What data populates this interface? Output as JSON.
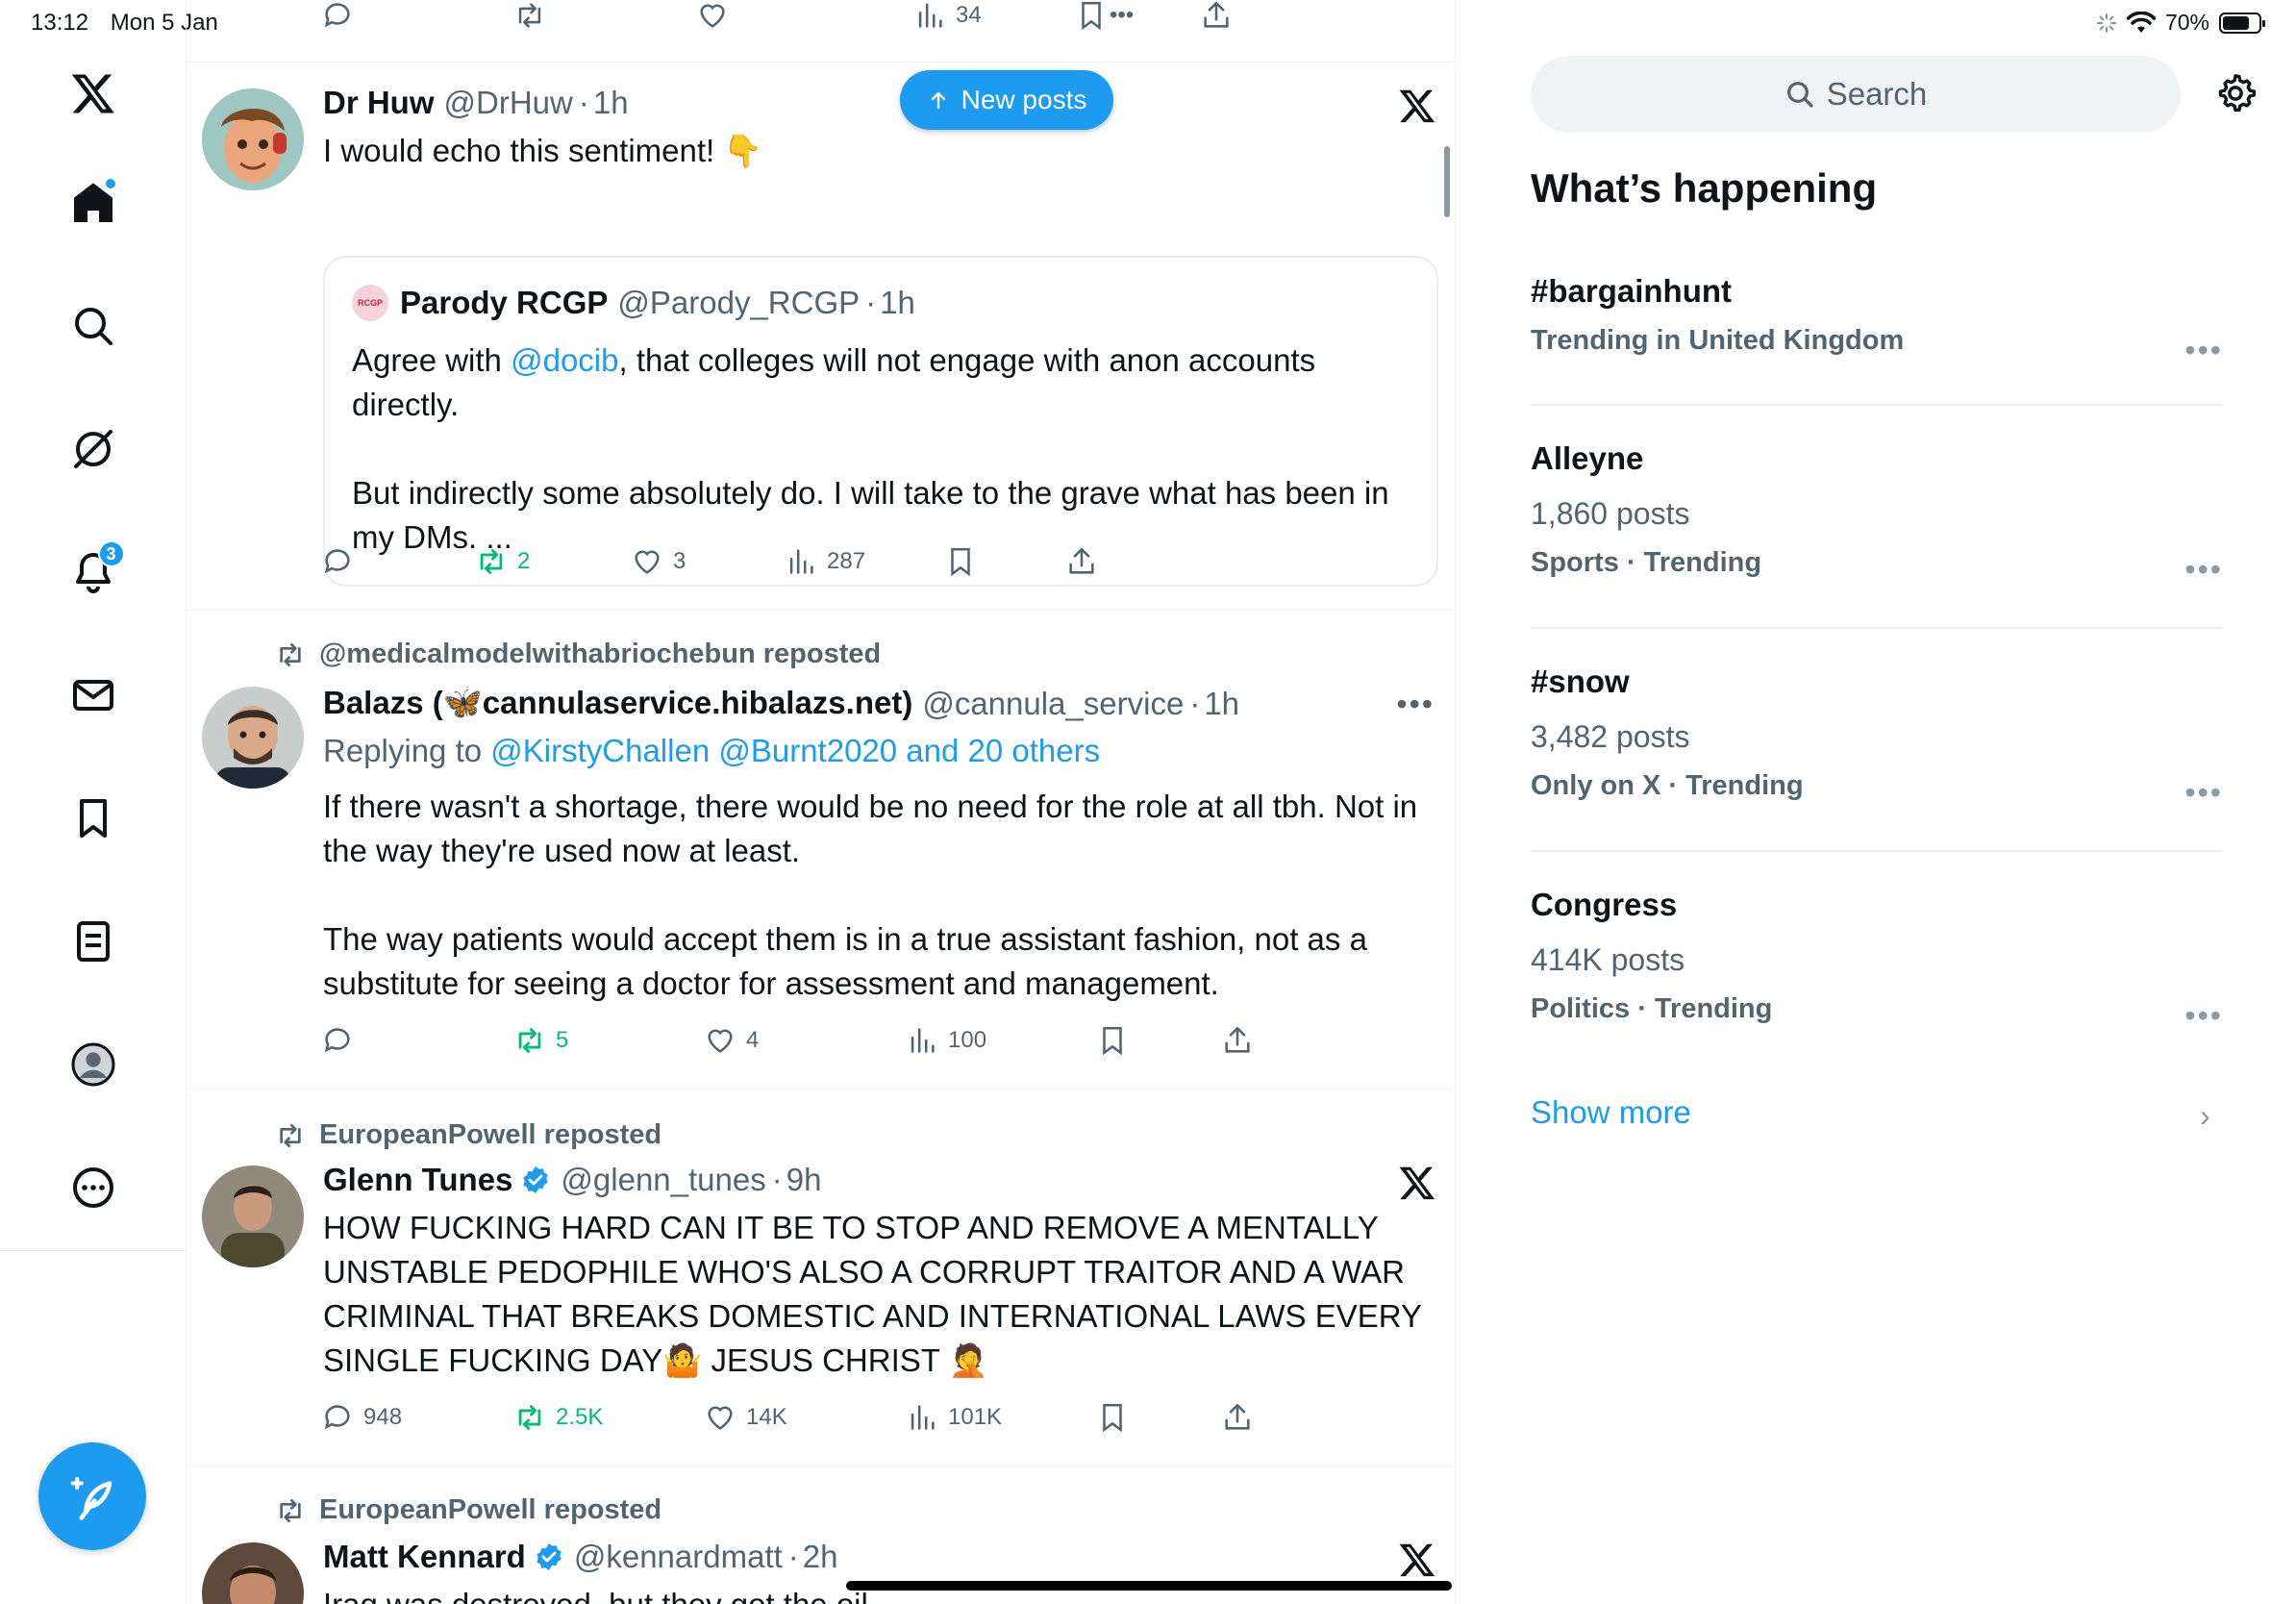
{
  "status_bar": {
    "time": "13:12",
    "date": "Mon 5 Jan",
    "battery": "70%",
    "battery_level": 0.7
  },
  "nav": {
    "notifications_badge": "3",
    "items": [
      "x-logo",
      "home",
      "search",
      "grok",
      "notifications",
      "messages",
      "bookmarks",
      "lists",
      "profile",
      "more"
    ]
  },
  "colors": {
    "accent": "#1d9bf0",
    "repost_green": "#00ba7c",
    "muted": "#536471"
  },
  "feed": {
    "top_actions": {
      "views": "34"
    },
    "new_posts_label": "New posts",
    "posts": [
      {
        "name": "Dr Huw",
        "handle": "@DrHuw",
        "time": "1h",
        "text": "I would echo this sentiment! 👇",
        "quote": {
          "name": "Parody RCGP",
          "handle": "@Parody_RCGP",
          "time": "1h",
          "avatar_text": "RCGP",
          "text_1": "Agree with ",
          "mention": "@docib",
          "text_2": ", that colleges will not engage with anon accounts directly.",
          "text_3": "But indirectly some absolutely do. I will take to the grave what has been in my DMs. ..."
        },
        "reposts": "2",
        "likes": "3",
        "views": "287"
      },
      {
        "repost_by": "@medicalmodelwithabriochebun reposted",
        "name": "Balazs (🦋cannulaservice.hibalazs.net)",
        "handle": "@cannula_service",
        "time": "1h",
        "replying_label": "Replying to ",
        "replying_to": "@KirstyChallen @Burnt2020 and 20 others",
        "text_1": "If there wasn't a shortage, there would be no need for the role at all tbh. Not in the way they're used now at least.",
        "text_2": "The way patients would accept them is in a true assistant fashion, not as a substitute for seeing a doctor for assessment and management.",
        "reposts": "5",
        "likes": "4",
        "views": "100"
      },
      {
        "repost_by": "EuropeanPowell reposted",
        "name": "Glenn Tunes",
        "handle": "@glenn_tunes",
        "time": "9h",
        "text": "HOW FUCKING HARD CAN IT BE TO STOP AND REMOVE A MENTALLY UNSTABLE PEDOPHILE WHO'S ALSO A CORRUPT TRAITOR AND A WAR CRIMINAL THAT BREAKS DOMESTIC AND INTERNATIONAL LAWS EVERY SINGLE FUCKING DAY🤷 JESUS CHRIST 🤦",
        "replies": "948",
        "reposts": "2.5K",
        "likes": "14K",
        "views": "101K"
      },
      {
        "repost_by": "EuropeanPowell reposted",
        "name": "Matt Kennard",
        "handle": "@kennardmatt",
        "time": "2h",
        "text": "Iraq was destroyed, but they got the oil"
      }
    ]
  },
  "sidebar": {
    "search_placeholder": "Search",
    "title": "What’s happening",
    "trends": [
      {
        "name": "#bargainhunt",
        "posts": "",
        "meta": "Trending in United Kingdom"
      },
      {
        "name": "Alleyne",
        "posts": "1,860 posts",
        "meta": "Sports · Trending"
      },
      {
        "name": "#snow",
        "posts": "3,482 posts",
        "meta": "Only on X · Trending"
      },
      {
        "name": "Congress",
        "posts": "414K posts",
        "meta": "Politics · Trending"
      }
    ],
    "show_more": "Show more"
  }
}
